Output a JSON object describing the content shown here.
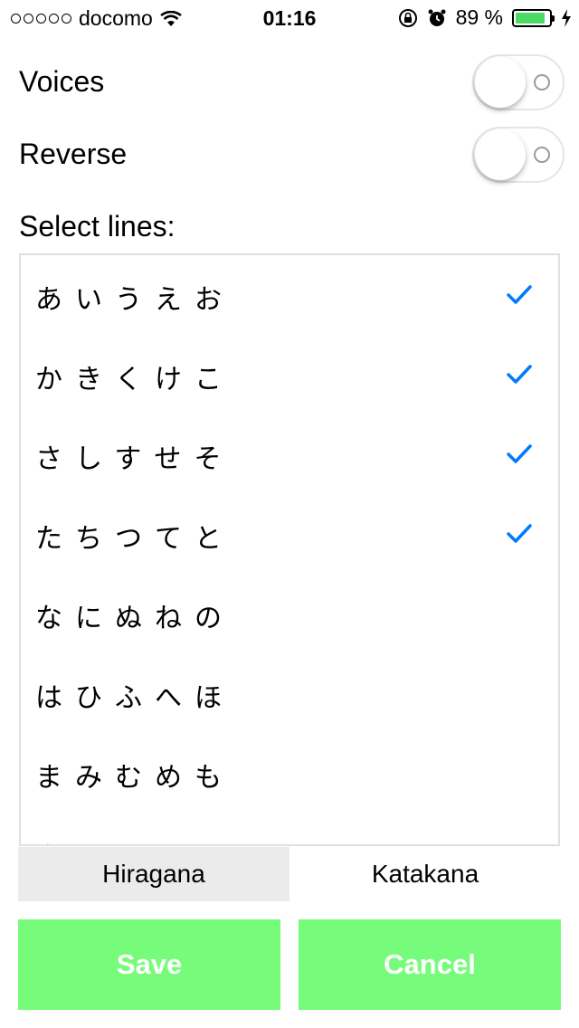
{
  "status_bar": {
    "carrier": "docomo",
    "time": "01:16",
    "battery_percent": "89 %",
    "battery_level": 0.89
  },
  "settings": {
    "voices_label": "Voices",
    "voices_on": false,
    "reverse_label": "Reverse",
    "reverse_on": false,
    "select_lines_label": "Select lines:"
  },
  "lines": [
    {
      "kana": "あいうえお",
      "checked": true
    },
    {
      "kana": "かきくけこ",
      "checked": true
    },
    {
      "kana": "さしすせそ",
      "checked": true
    },
    {
      "kana": "たちつてと",
      "checked": true
    },
    {
      "kana": "なにぬねの",
      "checked": false
    },
    {
      "kana": "はひふへほ",
      "checked": false
    },
    {
      "kana": "まみむめも",
      "checked": false
    },
    {
      "kana": "やゆよ",
      "checked": false
    }
  ],
  "tabs": [
    {
      "label": "Hiragana",
      "selected": true
    },
    {
      "label": "Katakana",
      "selected": false
    }
  ],
  "buttons": {
    "save_label": "Save",
    "cancel_label": "Cancel"
  },
  "colors": {
    "accent": "#007aff",
    "button_green": "#77fb7a",
    "battery_green": "#4cd964"
  }
}
